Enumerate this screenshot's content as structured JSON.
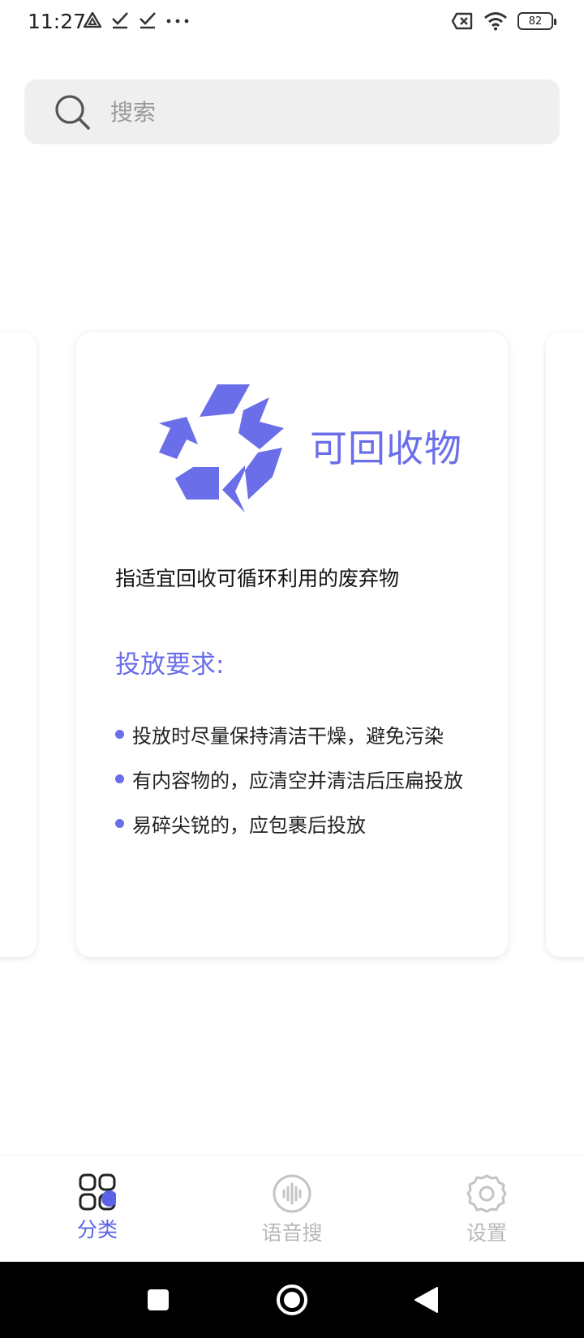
{
  "status_bar": {
    "time": "11:27",
    "battery": "82"
  },
  "search": {
    "placeholder": "搜索"
  },
  "card": {
    "title": "可回收物",
    "description": "指适宜回收可循环利用的废弃物",
    "requirements_title": "投放要求:",
    "requirements": [
      "投放时尽量保持清洁干燥，避免污染",
      "有内容物的，应清空并清洁后压扁投放",
      "易碎尖锐的，应包裹后投放"
    ]
  },
  "bottom_nav": {
    "items": [
      {
        "label": "分类",
        "icon": "grid-icon",
        "active": true
      },
      {
        "label": "语音搜",
        "icon": "voice-icon",
        "active": false
      },
      {
        "label": "设置",
        "icon": "gear-icon",
        "active": false
      }
    ]
  },
  "colors": {
    "accent": "#6a6ee8",
    "nav_active": "#5a63e6",
    "nav_inactive": "#b8b8b8",
    "search_bg": "#efefef"
  }
}
